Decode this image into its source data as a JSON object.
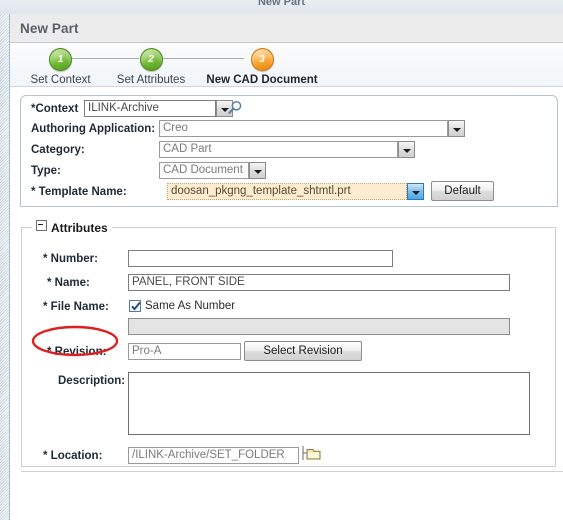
{
  "window": {
    "clipped_title": "New Part"
  },
  "header": {
    "title": "New Part"
  },
  "wizard": {
    "steps": [
      {
        "number": "1",
        "label": "Set Context",
        "state": "done"
      },
      {
        "number": "2",
        "label": "Set Attributes",
        "state": "done"
      },
      {
        "number": "3",
        "label": "New CAD Document",
        "state": "current"
      }
    ]
  },
  "context_panel": {
    "context": {
      "label": "*Context",
      "value": "ILINK-Archive",
      "search_icon": "magnifier-icon"
    },
    "authoring_application": {
      "label": "Authoring Application:",
      "value": "Creo"
    },
    "category": {
      "label": "Category:",
      "value": "CAD Part"
    },
    "type": {
      "label": "Type:",
      "value": "CAD Document"
    },
    "template_name": {
      "label": "* Template Name:",
      "value": "doosan_pkgng_template_shtmtl.prt",
      "default_button": "Default"
    }
  },
  "attributes": {
    "legend": "Attributes",
    "number": {
      "label": "* Number:",
      "value": "",
      "placeholder": ""
    },
    "name": {
      "label": "* Name:",
      "value": "PANEL, FRONT SIDE"
    },
    "file_name": {
      "label": "* File Name:",
      "checkbox_label": "Same As Number",
      "checkbox_checked": "true",
      "value": ""
    },
    "revision": {
      "label": "* Revision:",
      "value": "Pro-A",
      "select_button": "Select Revision"
    },
    "description": {
      "label": "Description:",
      "value": ""
    },
    "location": {
      "label": "* Location:",
      "value": "/ILINK-Archive/SET_FOLDER",
      "browse_icon": "folder-icon"
    }
  },
  "annotation": {
    "shape": "ellipse",
    "target": "* Number:",
    "color": "#e02020"
  },
  "colors": {
    "step_done": "#66b22a",
    "step_current": "#f59a1e",
    "highlight_field_bg": "#fdecd2",
    "annotation_red": "#e02020",
    "header_bg": "#ececed"
  }
}
